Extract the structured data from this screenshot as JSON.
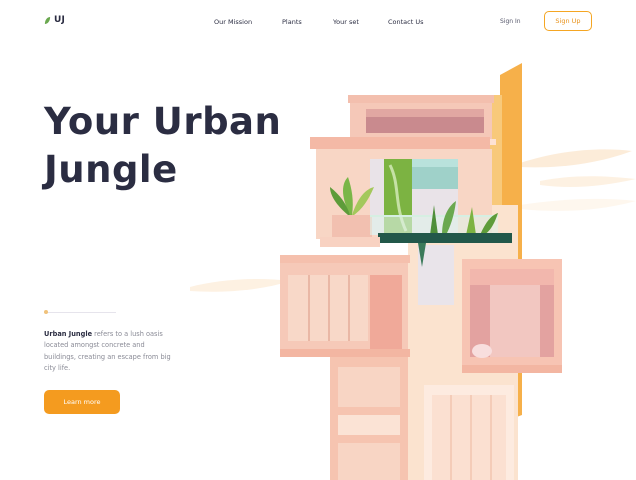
{
  "brand": {
    "name": "UJ"
  },
  "nav": {
    "items": [
      "Our Mission",
      "Plants",
      "Your set",
      "Contact Us"
    ],
    "signin": "Sign In",
    "signup": "Sign Up"
  },
  "hero": {
    "title_line1": "Your Urban",
    "title_line2": "Jungle",
    "desc_bold": "Urban Jungle",
    "desc_rest": " refers to a lush oasis located amongst concrete and buildings, creating an escape from big city life.",
    "cta": "Learn more"
  },
  "colors": {
    "accent": "#f49b1f",
    "text_dark": "#2b2d42",
    "brand_green": "#6aa84f"
  }
}
